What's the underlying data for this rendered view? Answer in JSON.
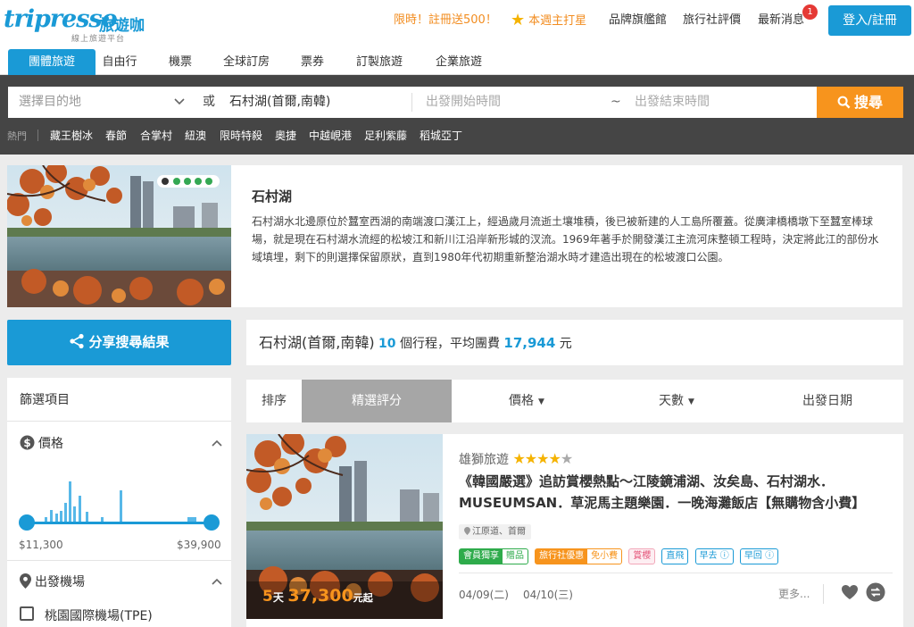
{
  "logo": {
    "word": "tripresso",
    "zh": "旅遊咖",
    "sub": "線上旅遊平台"
  },
  "header": {
    "promo": "限時！註冊送500！",
    "star_label": "本週主打星",
    "brand": "品牌旗艦館",
    "reviews": "旅行社評價",
    "news": "最新消息",
    "news_badge": "1",
    "login": "登入/註冊"
  },
  "tabs": [
    "團體旅遊",
    "自由行",
    "機票",
    "全球訂房",
    "票券",
    "訂製旅遊",
    "企業旅遊"
  ],
  "search": {
    "dest_placeholder": "選擇目的地",
    "or": "或",
    "dest_value": "石村湖(首爾,南韓)",
    "date_start": "出發開始時間",
    "tilde": "~",
    "date_end": "出發結束時間",
    "button": "搜尋"
  },
  "hot": {
    "label": "熱門",
    "tags": [
      "藏王樹冰",
      "春節",
      "合掌村",
      "紐澳",
      "限時特殺",
      "奧捷",
      "中越峴港",
      "足利紫藤",
      "稻城亞丁"
    ]
  },
  "intro": {
    "title": "石村湖",
    "description": "石村湖水北邊原位於蠶室西湖的南端渡口漢江上，經過歲月流逝土壤堆積，後已被新建的人工島所覆蓋。從廣津橋橋墩下至蠶室棒球場，就是現在石村湖水流經的松坡江和新川江沿岸新形城的汊流。1969年著手於開發漢江主流河床整頓工程時，決定將此江的部份水域填埋，剩下的則選擇保留原狀，直到1980年代初期重新整治湖水時才建造出現在的松坡渡口公園。"
  },
  "share": {
    "label": "分享搜尋結果"
  },
  "filter": {
    "title": "篩選項目",
    "price_title": "價格",
    "price_min": "$11,300",
    "price_max": "$39,900",
    "airport_title": "出發機場",
    "airport_option": "桃園國際機場(TPE)"
  },
  "summary": {
    "dest": "石村湖(首爾,南韓)",
    "count": "10",
    "count_unit": "個行程",
    "avg_label": "，平均團費",
    "avg_value": "17,944",
    "currency": "元"
  },
  "sort": {
    "label": "排序",
    "featured": "精選評分",
    "price": "價格",
    "days": "天數",
    "depart": "出發日期"
  },
  "card": {
    "days": "5",
    "day_unit": "天",
    "price": "37,300",
    "price_suffix": "元起",
    "agency": "雄獅旅遊",
    "rating": 4,
    "title": "《韓國嚴選》追訪賞櫻熱點～江陵鏡浦湖、汝矣島、石村湖水．MUSEUMSAN．草泥馬主題樂園．一晚海灘飯店【無購物含小費】",
    "location": "江原道、首爾",
    "tags": {
      "member_exclusive": "會員獨享",
      "gift": "贈品",
      "agency_discount": "旅行社優惠",
      "no_tip": "免小費",
      "cherry": "賞櫻",
      "direct": "直飛",
      "outbound": "早去",
      "return": "早回"
    },
    "date1": "04/09(二)",
    "date2": "04/10(三)",
    "more": "更多..."
  },
  "colors": {
    "brand": "#1a9ad6",
    "accent": "#f7941d",
    "dark_band": "#454545"
  }
}
